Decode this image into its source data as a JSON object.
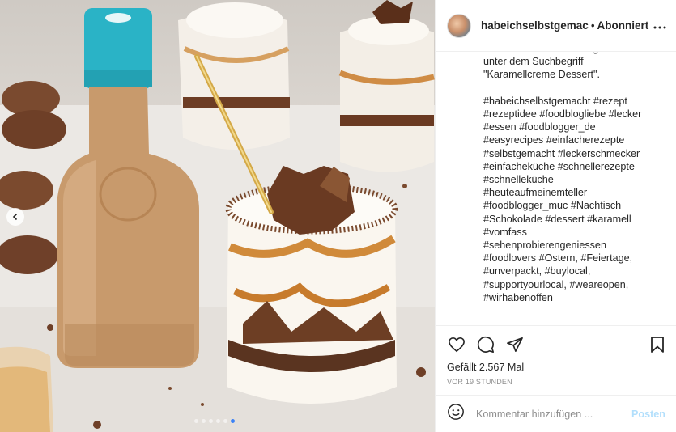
{
  "post": {
    "username": "habeichselbstgemac",
    "separator": "•",
    "follow_status": "Abonniert",
    "more_icon": "more-horizontal-icon",
    "caption": "oder auf habe-ich-selbstgemacht.de\nunter dem Suchbegriff\n\"Karamellcreme Dessert\".\n\n#habeichselbstgemacht #rezept\n#rezeptidee #foodblogliebe #lecker\n#essen #foodblogger_de\n#easyrecipes #einfacherezepte\n#selbstgemacht #leckerschmecker\n#einfacheküche #schnellerezepte\n#schnelleküche\n#heuteaufmeinemteller\n#foodblogger_muc #Nachtisch\n#Schokolade #dessert #karamell\n#vomfass\n#sehenprobierengeniessen\n#foodlovers #Ostern, #Feiertage,\n#unverpackt, #buylocal,\n#supportyourlocal, #weareopen,\n#wirhabenoffen",
    "likes_label": "Gefällt",
    "likes_count": "2.567",
    "likes_suffix": "Mal",
    "timestamp": "VOR 19 STUNDEN",
    "comment_placeholder": "Kommentar hinzufügen ...",
    "post_button": "Posten"
  },
  "carousel": {
    "prev_icon": "chevron-left-icon",
    "dot_count": 6,
    "active_dot": 5
  },
  "icons": {
    "like": "heart-icon",
    "comment": "comment-icon",
    "share": "send-icon",
    "save": "bookmark-icon",
    "emoji": "smiley-icon"
  },
  "colors": {
    "post_button": "#b2dffc",
    "text": "#262626",
    "muted": "#8e8e8e",
    "active_dot": "#3b82f6"
  }
}
